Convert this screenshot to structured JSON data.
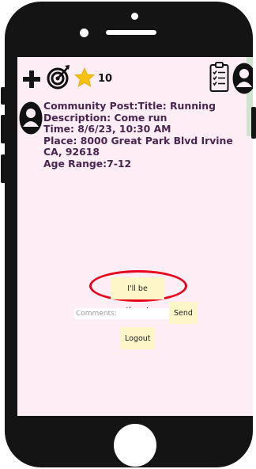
{
  "header": {
    "star_count": "10"
  },
  "icons": {
    "add": "plus-icon",
    "goals": "target-icon",
    "points": "star-icon",
    "tasks": "clipboard-icon",
    "profile": "user-icon"
  },
  "post": {
    "title_line": "Community Post:Title: Running",
    "description_line": "Description: Come run",
    "time_line": "Time: 8/6/23, 10:30 AM",
    "place_line": "Place: 8000 Great Park Blvd Irvine CA, 92618",
    "age_line": "Age Range:7-12"
  },
  "actions": {
    "attend_label": "I'll be there!",
    "comment_placeholder": "Comments:",
    "send_label": "Send",
    "logout_label": "Logout"
  },
  "colors": {
    "screen_bg": "#fdeef6",
    "button_bg": "#fdf6c8",
    "post_text": "#4a2550",
    "highlight_ring": "#e8001a",
    "star": "#f6c20e"
  }
}
